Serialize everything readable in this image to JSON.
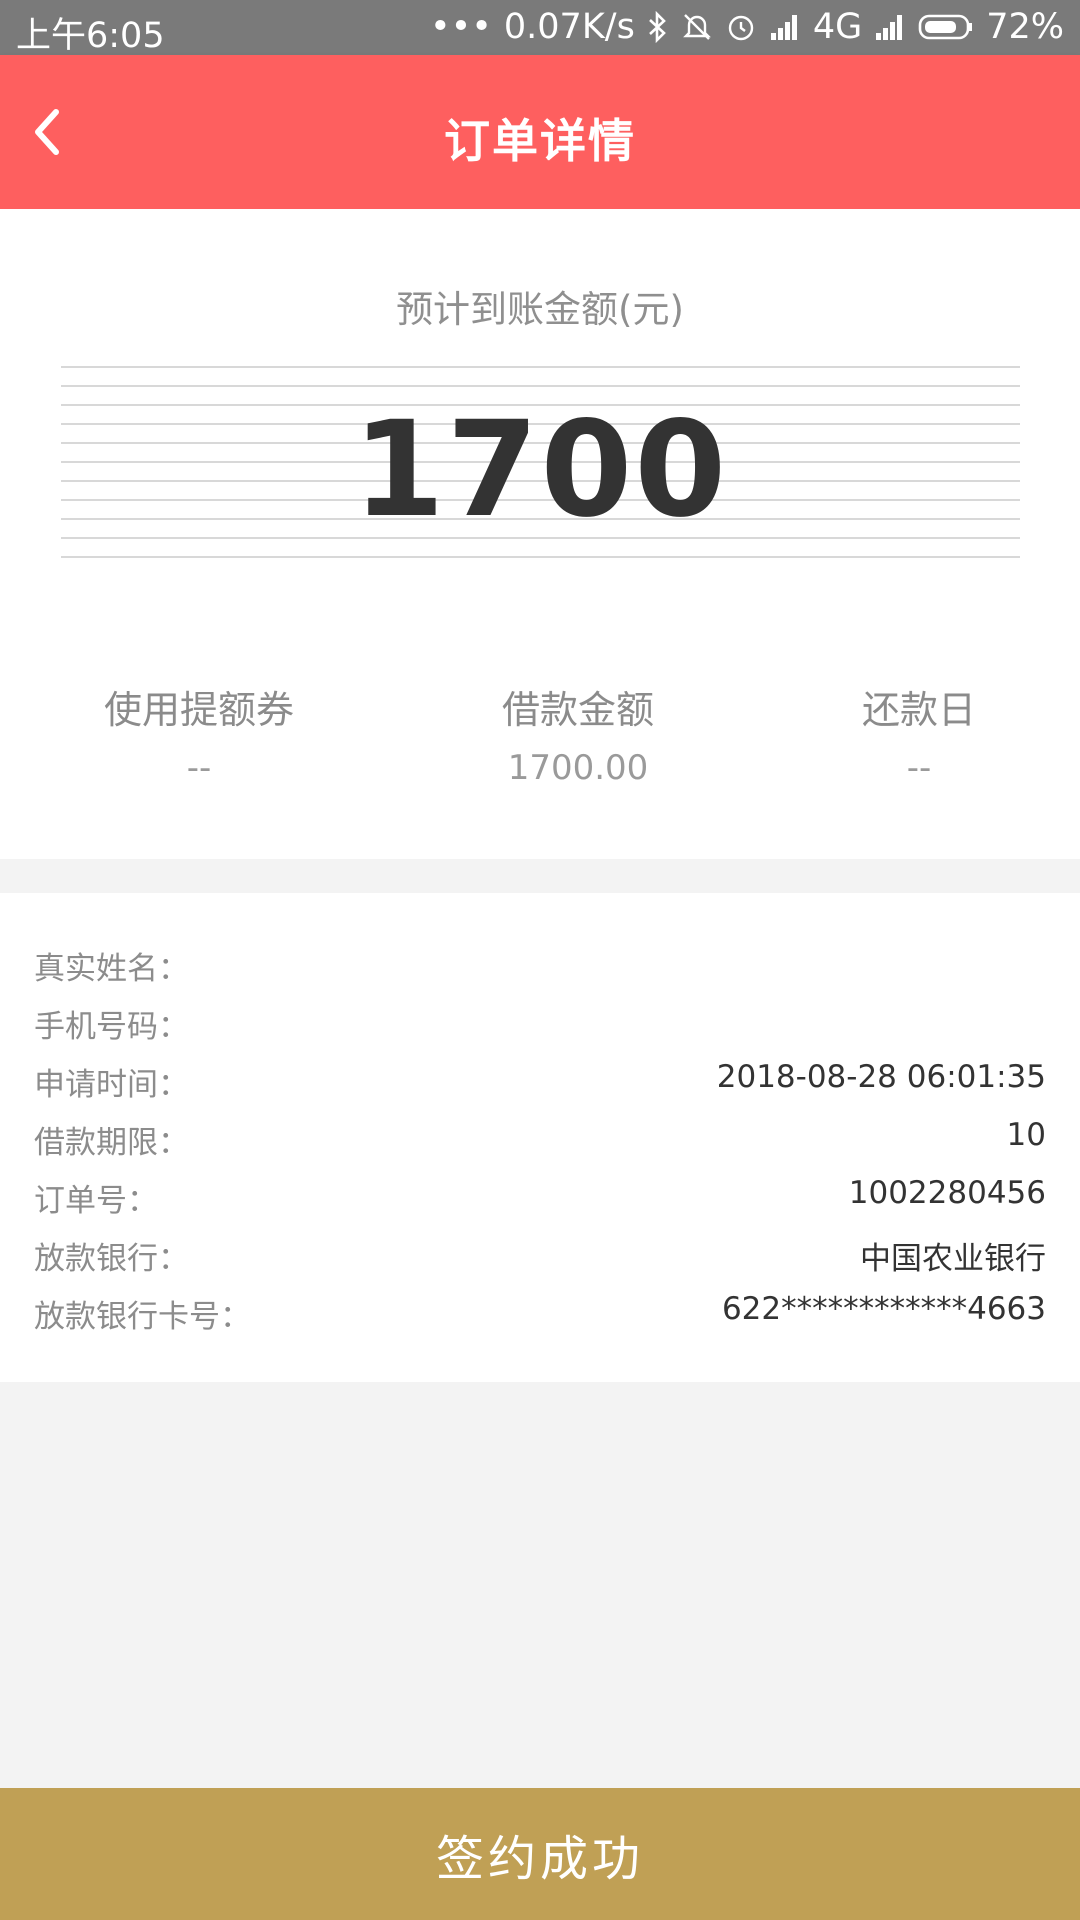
{
  "status_bar": {
    "time": "上午6:05",
    "dots": "•••",
    "net_speed": "0.07K/s",
    "network": "4G",
    "battery": "72%"
  },
  "header": {
    "title": "订单详情"
  },
  "summary": {
    "estimated_label": "预计到账金额(元)",
    "estimated_amount": "1700",
    "stats": [
      {
        "label": "使用提额券",
        "value": "--"
      },
      {
        "label": "借款金额",
        "value": "1700.00"
      },
      {
        "label": "还款日",
        "value": "--"
      }
    ]
  },
  "details": [
    {
      "label": "真实姓名：",
      "value": ""
    },
    {
      "label": "手机号码：",
      "value": ""
    },
    {
      "label": "申请时间：",
      "value": "2018-08-28 06:01:35"
    },
    {
      "label": "借款期限：",
      "value": "10"
    },
    {
      "label": "订单号：",
      "value": "1002280456"
    },
    {
      "label": "放款银行：",
      "value": "中国农业银行"
    },
    {
      "label": "放款银行卡号：",
      "value": "622************4663"
    }
  ],
  "footer": {
    "button_label": "签约成功"
  }
}
